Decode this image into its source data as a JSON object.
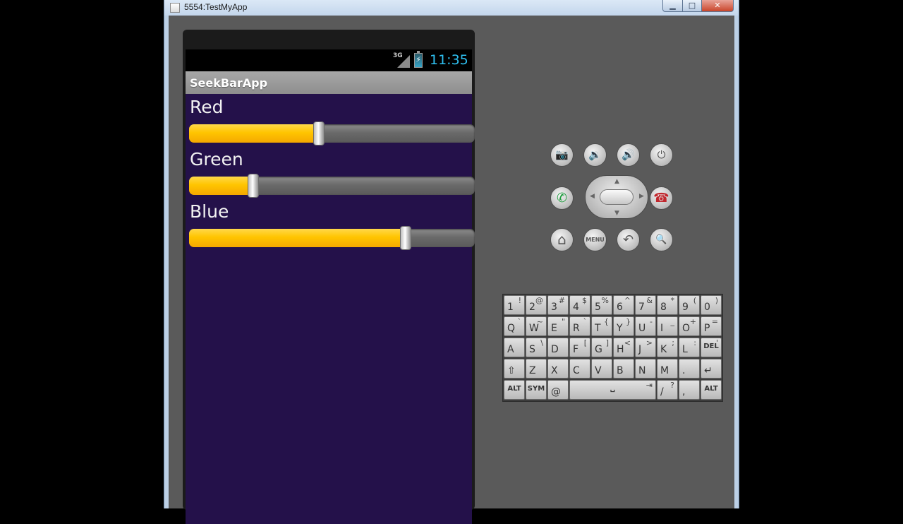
{
  "window": {
    "title": "5554:TestMyApp",
    "minimize": "▁",
    "maximize": "□",
    "close": "✕"
  },
  "status_bar": {
    "network": "3G",
    "time": "11:35"
  },
  "app": {
    "title": "SeekBarApp",
    "background": "#24114a",
    "accent": "#ffc500",
    "seekbars": [
      {
        "label": "Red",
        "progress_fraction": 0.454
      },
      {
        "label": "Green",
        "progress_fraction": 0.224
      },
      {
        "label": "Blue",
        "progress_fraction": 0.758
      }
    ]
  },
  "controls": {
    "camera": "📷",
    "volume_down": "🔉",
    "volume_up": "🔊",
    "power": "⏻",
    "call": "✆",
    "end_call": "☎",
    "home": "⌂",
    "menu": "MENU",
    "back": "↶",
    "search": "🔍"
  },
  "keyboard": {
    "rows": [
      [
        [
          "1",
          "!"
        ],
        [
          "2",
          "@"
        ],
        [
          "3",
          "#"
        ],
        [
          "4",
          "$"
        ],
        [
          "5",
          "%"
        ],
        [
          "6",
          "^"
        ],
        [
          "7",
          "&"
        ],
        [
          "8",
          "*"
        ],
        [
          "9",
          "("
        ],
        [
          "0",
          ")"
        ]
      ],
      [
        [
          "Q",
          "`"
        ],
        [
          "W",
          "~"
        ],
        [
          "E",
          "\""
        ],
        [
          "R",
          "`"
        ],
        [
          "T",
          "{"
        ],
        [
          "Y",
          "}"
        ],
        [
          "U",
          "-"
        ],
        [
          "I",
          "_"
        ],
        [
          "O",
          "+"
        ],
        [
          "P",
          "="
        ]
      ],
      [
        [
          "A",
          ""
        ],
        [
          "S",
          "\\"
        ],
        [
          "D",
          ""
        ],
        [
          "F",
          "["
        ],
        [
          "G",
          "]"
        ],
        [
          "H",
          "<"
        ],
        [
          "J",
          ">"
        ],
        [
          "K",
          ";"
        ],
        [
          "L",
          ":"
        ],
        [
          "DEL",
          "'"
        ]
      ],
      [
        [
          "⇧",
          ""
        ],
        [
          "Z",
          ""
        ],
        [
          "X",
          ""
        ],
        [
          "C",
          ""
        ],
        [
          "V",
          ""
        ],
        [
          "B",
          ""
        ],
        [
          "N",
          ""
        ],
        [
          "M",
          ""
        ],
        [
          ".",
          ""
        ],
        [
          "↵",
          ""
        ]
      ]
    ],
    "bottom": {
      "alt_left": "ALT",
      "sym": "SYM",
      "at": "@",
      "space": "␣",
      "tab": "⇥",
      "slash": "/",
      "question": "?",
      "comma": ",",
      "alt_right": "ALT"
    }
  }
}
